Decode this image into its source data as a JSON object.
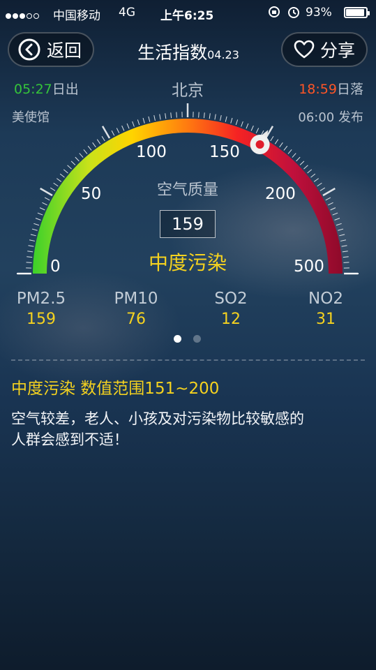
{
  "status_bar": {
    "carrier": "中国移动",
    "network": "4G",
    "time": "上午6:25",
    "battery": "93%",
    "battery_level": 0.93
  },
  "nav": {
    "back_label": "返回",
    "title": "生活指数",
    "date": "04.23",
    "share_label": "分享"
  },
  "sun": {
    "sunrise_time": "05:27",
    "sunrise_label": "日出",
    "city": "北京",
    "sunset_time": "18:59",
    "sunset_label": "日落"
  },
  "source": {
    "station": "美使馆",
    "publish": "06:00 发布"
  },
  "gauge": {
    "tick_labels": [
      "0",
      "50",
      "100",
      "150",
      "200",
      "500"
    ],
    "title": "空气质量",
    "value": "159",
    "level": "中度污染"
  },
  "pollutants": [
    {
      "name": "PM2.5",
      "value": "159"
    },
    {
      "name": "PM10",
      "value": "76"
    },
    {
      "name": "SO2",
      "value": "12"
    },
    {
      "name": "NO2",
      "value": "31"
    }
  ],
  "pager": {
    "pages": 2,
    "active": 0
  },
  "description": {
    "heading": "中度污染 数值范围151~200",
    "line1": "空气较差，老人、小孩及对污染物比较敏感的",
    "line2": "人群会感到不适！"
  },
  "colors": {
    "sunrise": "#35c43a",
    "sunset": "#ff5526",
    "highlight": "#f5d21f"
  }
}
